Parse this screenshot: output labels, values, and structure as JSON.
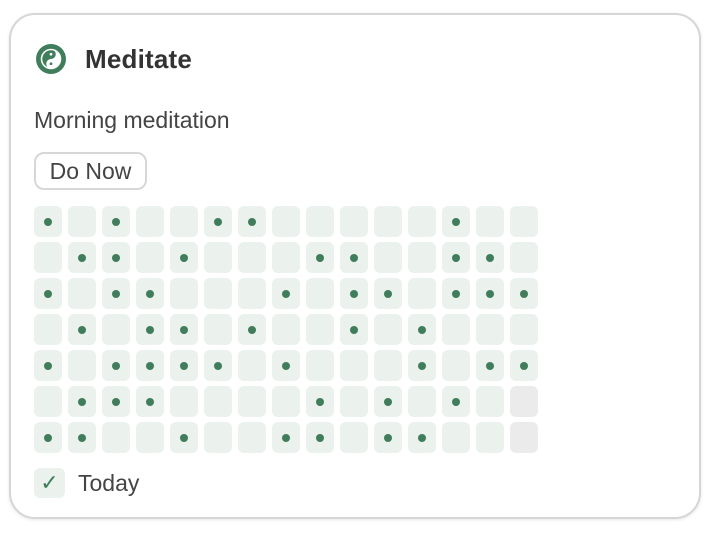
{
  "habit": {
    "icon": "yin-yang-icon",
    "title": "Meditate",
    "description": "Morning meditation",
    "do_now_label": "Do Now"
  },
  "history": {
    "columns": 15,
    "rows": 7,
    "cells": [
      [
        1,
        0,
        1,
        0,
        0,
        1,
        1,
        0,
        0,
        0,
        0,
        0,
        1,
        0,
        0
      ],
      [
        0,
        1,
        1,
        0,
        1,
        0,
        0,
        0,
        1,
        1,
        0,
        0,
        1,
        1,
        0
      ],
      [
        1,
        0,
        1,
        1,
        0,
        0,
        0,
        1,
        0,
        1,
        1,
        0,
        1,
        1,
        1
      ],
      [
        0,
        1,
        0,
        1,
        1,
        0,
        1,
        0,
        0,
        1,
        0,
        1,
        0,
        0,
        0
      ],
      [
        1,
        0,
        1,
        1,
        1,
        1,
        0,
        1,
        0,
        0,
        0,
        1,
        0,
        1,
        1
      ],
      [
        0,
        1,
        1,
        1,
        0,
        0,
        0,
        0,
        1,
        0,
        1,
        0,
        1,
        0,
        2
      ],
      [
        1,
        1,
        0,
        0,
        1,
        0,
        0,
        1,
        1,
        0,
        1,
        1,
        0,
        0,
        2
      ]
    ]
  },
  "today": {
    "checked": true,
    "check_glyph": "✓",
    "label": "Today"
  },
  "colors": {
    "accent": "#3f7d5b",
    "cell_empty": "#ebf1ec",
    "cell_future": "#ebebeb",
    "card_border": "#d6d6d6"
  }
}
